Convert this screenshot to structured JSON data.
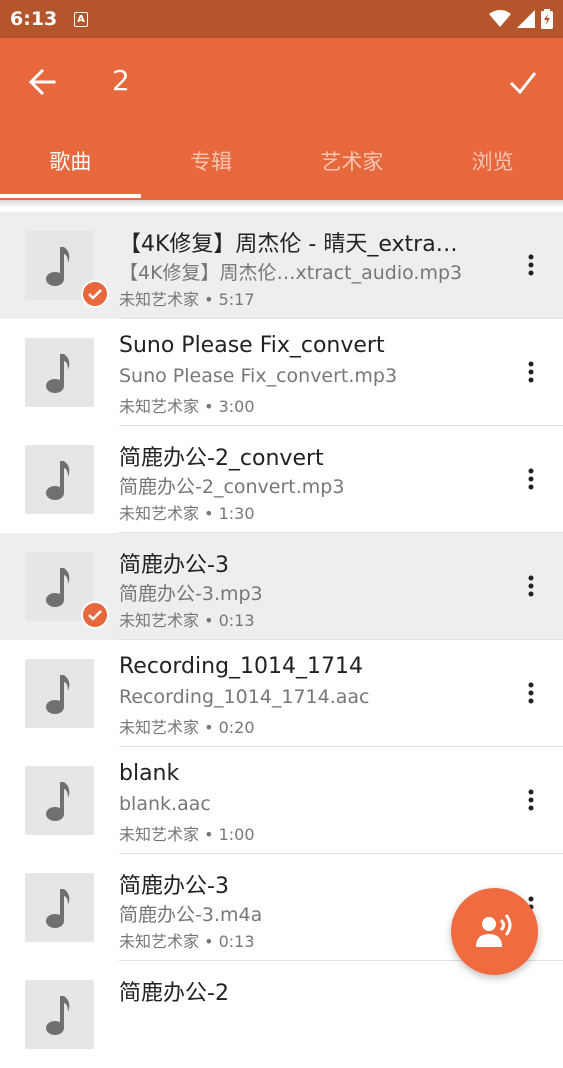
{
  "status_bar": {
    "time": "6:13",
    "indicator_letter": "A"
  },
  "app_bar": {
    "title": "2",
    "back_icon": "arrow-left-icon",
    "confirm_icon": "check-icon"
  },
  "tabs": [
    {
      "label": "歌曲",
      "active": true
    },
    {
      "label": "专辑",
      "active": false
    },
    {
      "label": "艺术家",
      "active": false
    },
    {
      "label": "浏览",
      "active": false
    }
  ],
  "songs": [
    {
      "title": "【4K修复】周杰伦 - 晴天_extra…",
      "file": "【4K修复】周杰伦…xtract_audio.mp3",
      "meta": "未知艺术家 • 5:17",
      "selected": true
    },
    {
      "title": "Suno Please Fix_convert",
      "file": "Suno Please Fix_convert.mp3",
      "meta": "未知艺术家 • 3:00",
      "selected": false
    },
    {
      "title": "简鹿办公-2_convert",
      "file": "简鹿办公-2_convert.mp3",
      "meta": "未知艺术家 • 1:30",
      "selected": false
    },
    {
      "title": "简鹿办公-3",
      "file": "简鹿办公-3.mp3",
      "meta": "未知艺术家 • 0:13",
      "selected": true
    },
    {
      "title": "Recording_1014_1714",
      "file": "Recording_1014_1714.aac",
      "meta": "未知艺术家 • 0:20",
      "selected": false
    },
    {
      "title": "blank",
      "file": "blank.aac",
      "meta": "未知艺术家 • 1:00",
      "selected": false
    },
    {
      "title": "简鹿办公-3",
      "file": "简鹿办公-3.m4a",
      "meta": "未知艺术家 • 0:13",
      "selected": false
    },
    {
      "title": "简鹿办公-2",
      "file": "",
      "meta": "",
      "selected": false
    }
  ],
  "fab": {
    "icon": "voice-recognition-icon"
  },
  "colors": {
    "accent": "#e6683c",
    "status_bar": "#b5552b",
    "selected_row": "#eeeeee"
  }
}
